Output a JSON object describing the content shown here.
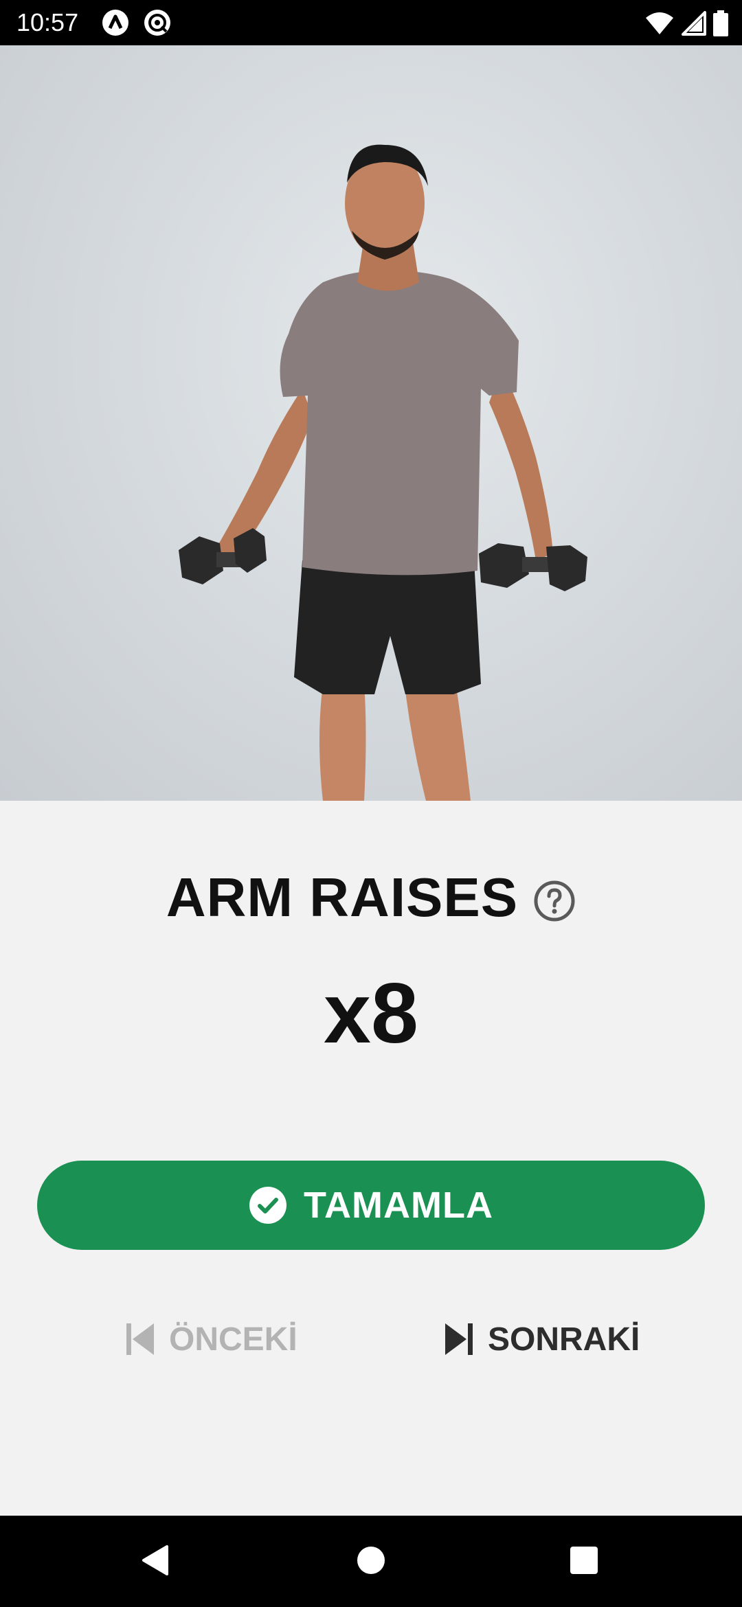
{
  "status_bar": {
    "time": "10:57",
    "icons": [
      "autonomous-a-icon",
      "at-sign-icon",
      "wifi-icon",
      "signal-icon",
      "battery-icon"
    ]
  },
  "hero": {
    "image": "man-performing-dumbbell-arm-raises"
  },
  "exercise": {
    "name": "ARM RAISES",
    "reps": "x8"
  },
  "actions": {
    "complete_label": "TAMAMLA",
    "previous_label": "ÖNCEKİ",
    "next_label": "SONRAKİ"
  },
  "colors": {
    "accent": "#1a9152",
    "disabled": "#b3b3b3",
    "text": "#111111"
  }
}
